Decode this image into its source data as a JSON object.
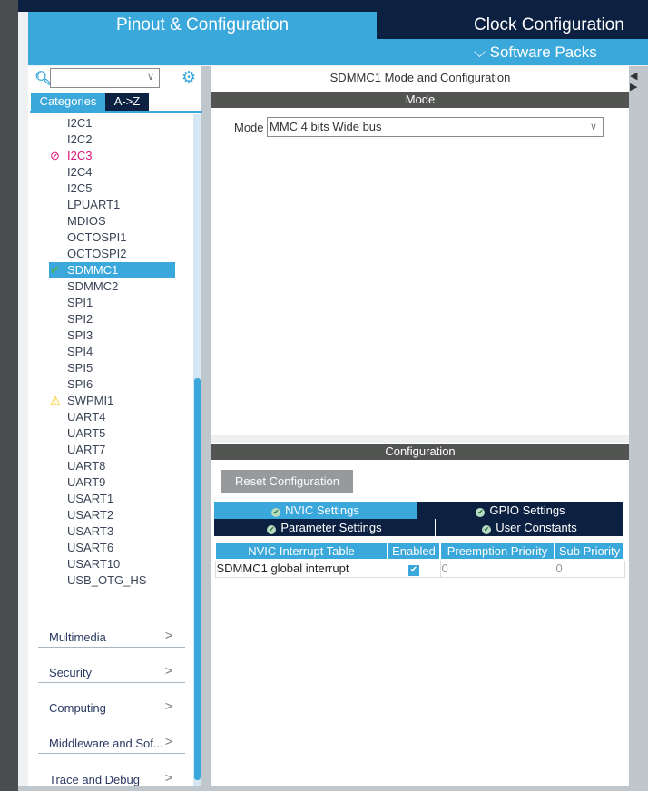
{
  "header": {
    "tab_pinout": "Pinout & Configuration",
    "tab_clock": "Clock Configuration",
    "software_packs": "Software Packs"
  },
  "sidebar": {
    "search_value": "",
    "tabs": [
      "Categories",
      "A->Z"
    ],
    "peripherals": [
      {
        "label": "I2C1",
        "status": ""
      },
      {
        "label": "I2C2",
        "status": ""
      },
      {
        "label": "I2C3",
        "status": "error"
      },
      {
        "label": "I2C4",
        "status": ""
      },
      {
        "label": "I2C5",
        "status": ""
      },
      {
        "label": "LPUART1",
        "status": ""
      },
      {
        "label": "MDIOS",
        "status": ""
      },
      {
        "label": "OCTOSPI1",
        "status": ""
      },
      {
        "label": "OCTOSPI2",
        "status": ""
      },
      {
        "label": "SDMMC1",
        "status": "ok-selected"
      },
      {
        "label": "SDMMC2",
        "status": ""
      },
      {
        "label": "SPI1",
        "status": ""
      },
      {
        "label": "SPI2",
        "status": ""
      },
      {
        "label": "SPI3",
        "status": ""
      },
      {
        "label": "SPI4",
        "status": ""
      },
      {
        "label": "SPI5",
        "status": ""
      },
      {
        "label": "SPI6",
        "status": ""
      },
      {
        "label": "SWPMI1",
        "status": "warning"
      },
      {
        "label": "UART4",
        "status": ""
      },
      {
        "label": "UART5",
        "status": ""
      },
      {
        "label": "UART7",
        "status": ""
      },
      {
        "label": "UART8",
        "status": ""
      },
      {
        "label": "UART9",
        "status": ""
      },
      {
        "label": "USART1",
        "status": ""
      },
      {
        "label": "USART2",
        "status": ""
      },
      {
        "label": "USART3",
        "status": ""
      },
      {
        "label": "USART6",
        "status": ""
      },
      {
        "label": "USART10",
        "status": ""
      },
      {
        "label": "USB_OTG_HS",
        "status": ""
      }
    ],
    "categories": [
      "Multimedia",
      "Security",
      "Computing",
      "Middleware and Sof...",
      "Trace and Debug"
    ]
  },
  "main": {
    "title": "SDMMC1 Mode and Configuration",
    "mode_header": "Mode",
    "mode_label": "Mode",
    "mode_value": "MMC 4 bits Wide bus",
    "config_header": "Configuration",
    "reset_label": "Reset Configuration",
    "tabs": [
      "NVIC Settings",
      "GPIO Settings",
      "Parameter Settings",
      "User Constants"
    ],
    "table": {
      "headers": [
        "NVIC Interrupt Table",
        "Enabled",
        "Preemption Priority",
        "Sub Priority"
      ],
      "rows": [
        {
          "name": "SDMMC1 global interrupt",
          "enabled": true,
          "preemption": "0",
          "sub": "0"
        }
      ]
    }
  },
  "colors": {
    "accent": "#3aa8db",
    "navy": "#0c2142",
    "error": "#e0127a",
    "ok": "#4caf50",
    "warning": "#f5c400"
  }
}
